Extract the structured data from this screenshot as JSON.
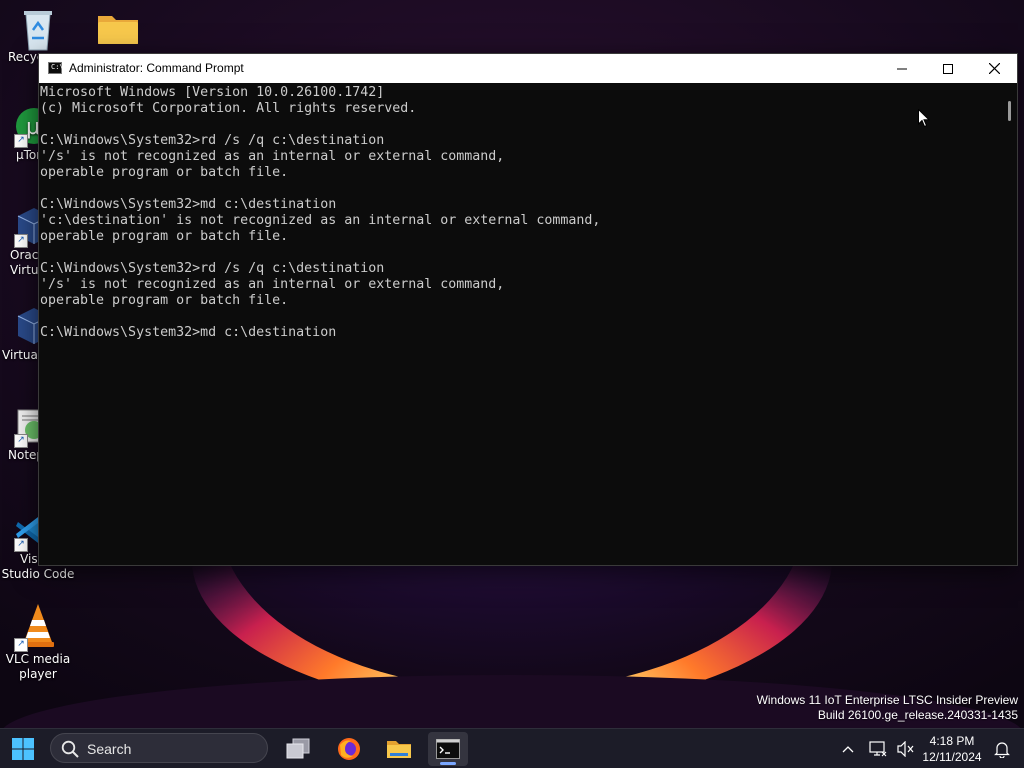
{
  "desktop": {
    "icons": [
      {
        "label": "Recyc"
      },
      {
        "label": ""
      },
      {
        "label": "µTor"
      },
      {
        "label": "Oracl Virtu"
      },
      {
        "label": "Virtual"
      },
      {
        "label": "Notep"
      },
      {
        "label": "Visual Studio Code"
      },
      {
        "label": "VLC media player"
      }
    ],
    "watermark": {
      "line1": "Windows 11 IoT Enterprise LTSC Insider Preview",
      "line2": "Build 26100.ge_release.240331-1435"
    }
  },
  "window": {
    "title": "Administrator: Command Prompt",
    "icon": "cmd-icon",
    "controls": {
      "minimize": "minimize-icon",
      "maximize": "maximize-icon",
      "close": "close-icon"
    }
  },
  "console": {
    "lines": [
      "Microsoft Windows [Version 10.0.26100.1742]",
      "(c) Microsoft Corporation. All rights reserved.",
      "",
      "C:\\Windows\\System32>rd /s /q c:\\destination",
      "'/s' is not recognized as an internal or external command,",
      "operable program or batch file.",
      "",
      "C:\\Windows\\System32>md c:\\destination",
      "'c:\\destination' is not recognized as an internal or external command,",
      "operable program or batch file.",
      "",
      "C:\\Windows\\System32>rd /s /q c:\\destination",
      "'/s' is not recognized as an internal or external command,",
      "operable program or batch file.",
      "",
      "C:\\Windows\\System32>md c:\\destination"
    ],
    "colors": {
      "background": "#0c0c0c",
      "text": "#cccccc"
    }
  },
  "taskbar": {
    "search_placeholder": "Search",
    "apps": [
      "task-view-icon",
      "firefox-icon",
      "file-explorer-icon",
      "terminal-icon"
    ],
    "clock": {
      "time": "4:18 PM",
      "date": "12/11/2024"
    },
    "tray": [
      "chevron-up-icon",
      "network-icon",
      "volume-muted-icon",
      "notification-bell-icon"
    ]
  }
}
